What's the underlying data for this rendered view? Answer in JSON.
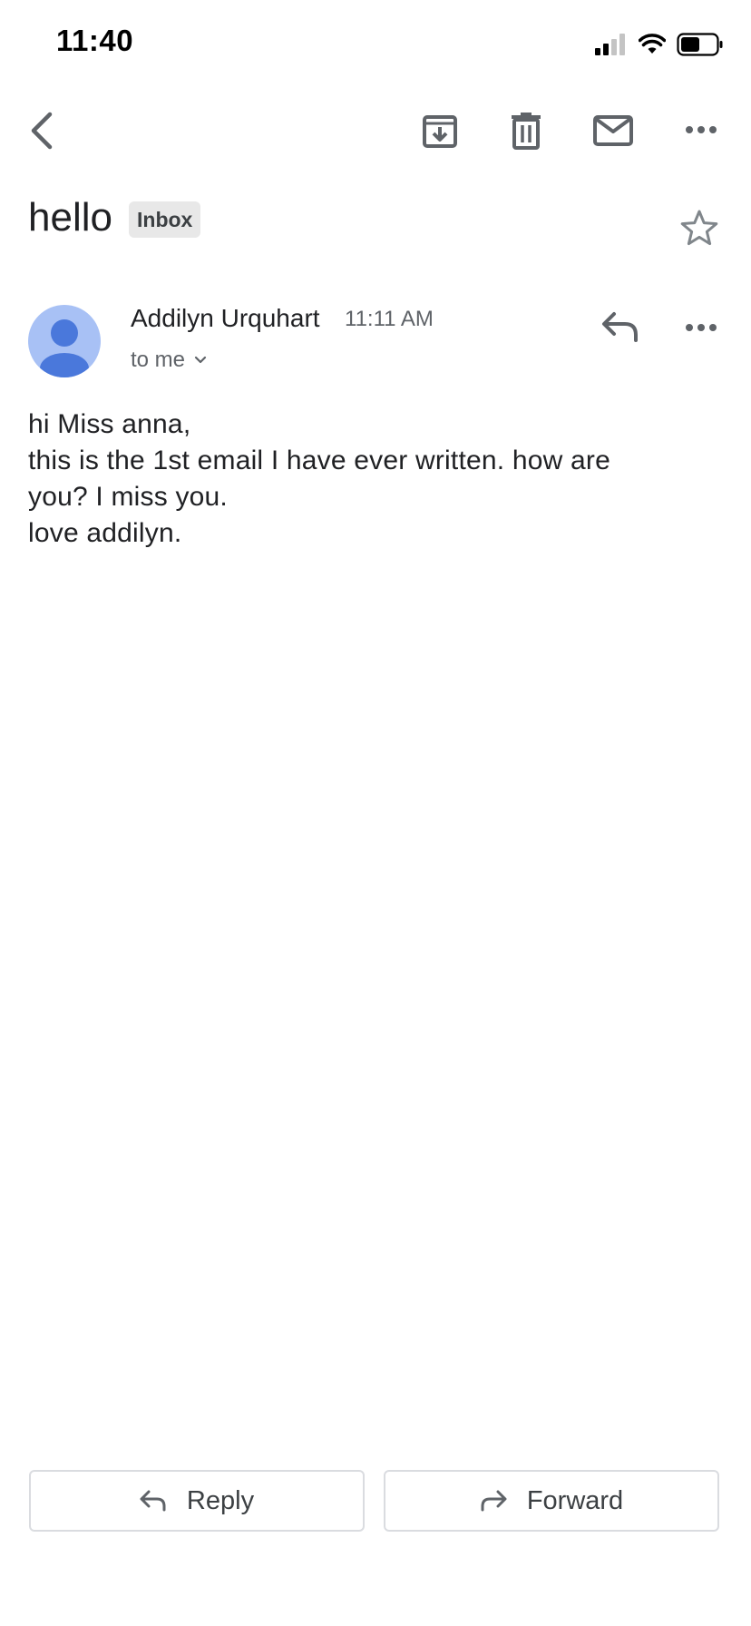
{
  "status_bar": {
    "time": "11:40",
    "icons": [
      "cellular-signal-icon",
      "wifi-icon",
      "battery-icon"
    ]
  },
  "toolbar": {
    "icons": [
      "back-icon",
      "archive-icon",
      "trash-icon",
      "mark-unread-icon",
      "more-options-icon"
    ]
  },
  "email": {
    "subject": "hello",
    "label": "Inbox",
    "starred": false,
    "sender": {
      "name": "Addilyn Urquhart",
      "time": "11:11 AM",
      "recipient_summary": "to me"
    },
    "body_lines": [
      "hi Miss anna,",
      "this is the 1st email I have ever written. how are",
      "you? I miss you.",
      "love addilyn."
    ]
  },
  "actions": {
    "reply_label": "Reply",
    "forward_label": "Forward"
  },
  "colors": {
    "avatar_bg": "#a8c1f5",
    "avatar_fg": "#4a78db",
    "icon_gray": "#5f6368",
    "chip_bg": "#e8e8e8",
    "border": "#dadce0"
  }
}
